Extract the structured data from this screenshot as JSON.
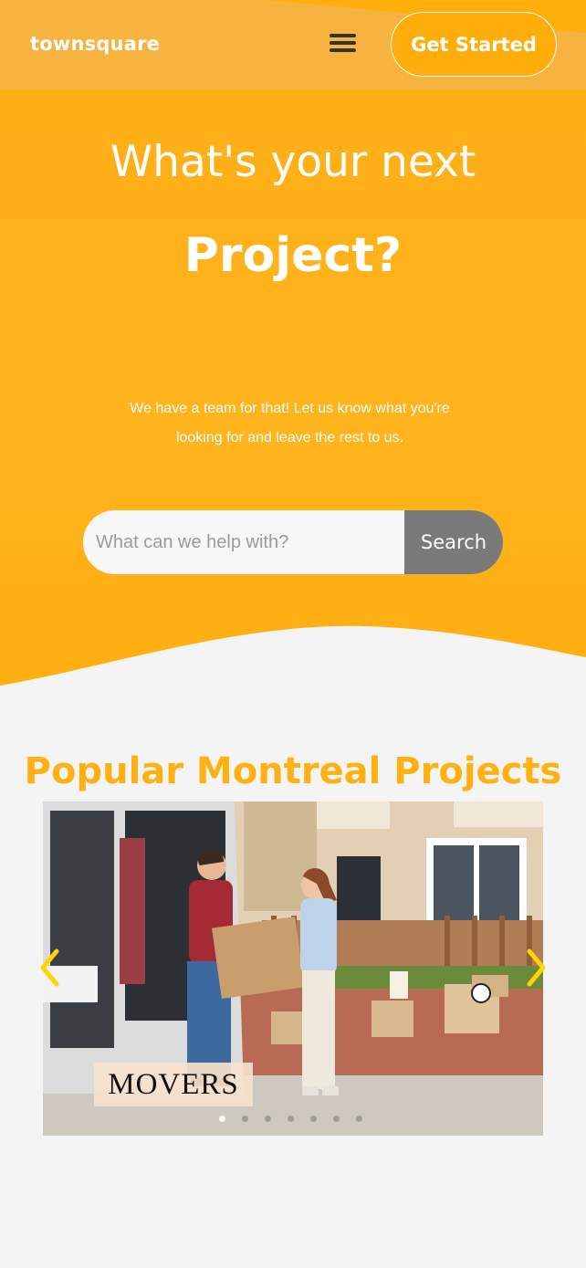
{
  "header": {
    "logo": "townsquare",
    "cta_label": "Get Started"
  },
  "hero": {
    "line1": "What's your next",
    "line2": "Project?",
    "subtitle": "We have a team for that! Let us know what you're looking for and leave the rest to us."
  },
  "search": {
    "placeholder": "What can we help with?",
    "value": "",
    "button_label": "Search"
  },
  "popular": {
    "title": "Popular Montreal Projects",
    "slide_caption": "MOVERS",
    "slide_count": 7,
    "active_slide": 1
  },
  "colors": {
    "brand_orange": "#ffad0a",
    "title_orange": "#ffb114",
    "search_button": "#7a7a7a",
    "arrow_yellow": "#ffd400"
  },
  "icons": {
    "menu": "hamburger-menu-icon",
    "prev": "chevron-left-icon",
    "next": "chevron-right-icon"
  }
}
